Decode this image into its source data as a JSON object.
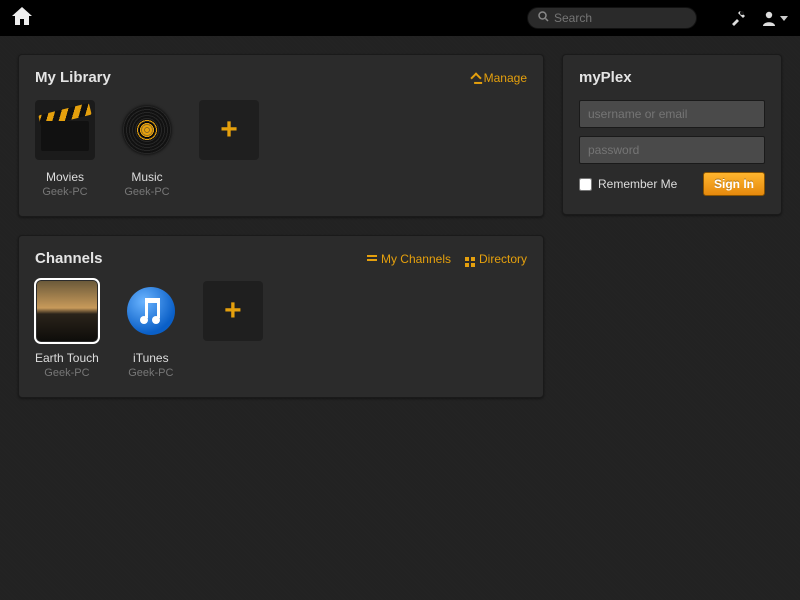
{
  "colors": {
    "accent": "#e5a00d"
  },
  "topbar": {
    "search_placeholder": "Search"
  },
  "library": {
    "title": "My Library",
    "manage_label": "Manage",
    "items": [
      {
        "label": "Movies",
        "sub": "Geek-PC",
        "icon": "clapper-icon"
      },
      {
        "label": "Music",
        "sub": "Geek-PC",
        "icon": "vinyl-icon"
      }
    ]
  },
  "channels": {
    "title": "Channels",
    "my_channels_label": "My Channels",
    "directory_label": "Directory",
    "items": [
      {
        "label": "Earth Touch",
        "sub": "Geek-PC",
        "icon": "earth-touch-thumb",
        "selected": true
      },
      {
        "label": "iTunes",
        "sub": "Geek-PC",
        "icon": "itunes-icon",
        "selected": false
      }
    ]
  },
  "myplex": {
    "title": "myPlex",
    "username_placeholder": "username or email",
    "password_placeholder": "password",
    "remember_label": "Remember Me",
    "signin_label": "Sign In"
  }
}
